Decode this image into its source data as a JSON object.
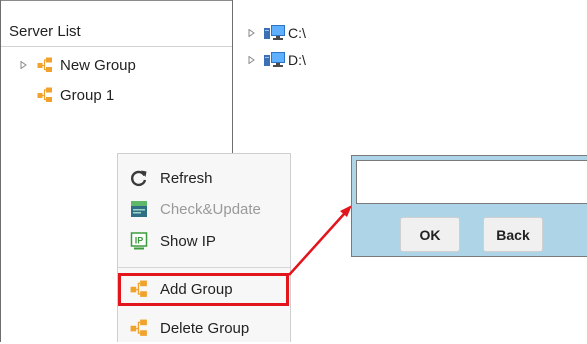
{
  "server_list": {
    "title": "Server List",
    "items": [
      {
        "label": "New Group",
        "icon": "group-icon",
        "expandable": true
      },
      {
        "label": "Group 1",
        "icon": "group-icon",
        "expandable": false
      }
    ]
  },
  "drives": [
    {
      "label": "C:\\",
      "icon": "drive-computer-icon"
    },
    {
      "label": "D:\\",
      "icon": "drive-computer-icon"
    }
  ],
  "context_menu": {
    "items": [
      {
        "label": "Refresh",
        "icon": "refresh-icon",
        "enabled": true
      },
      {
        "label": "Check&Update",
        "icon": "check-update-icon",
        "enabled": false
      },
      {
        "label": "Show IP",
        "icon": "ip-icon",
        "enabled": true
      },
      {
        "label": "Add Group",
        "icon": "group-icon",
        "enabled": true,
        "highlighted": true
      },
      {
        "label": "Delete Group",
        "icon": "group-icon",
        "enabled": true
      }
    ]
  },
  "dialog": {
    "input_value": "",
    "ok_label": "OK",
    "back_label": "Back"
  },
  "colors": {
    "highlight": "#e2141c",
    "dialog_bg": "#aed4e8",
    "group_icon": "#f0a22c"
  }
}
